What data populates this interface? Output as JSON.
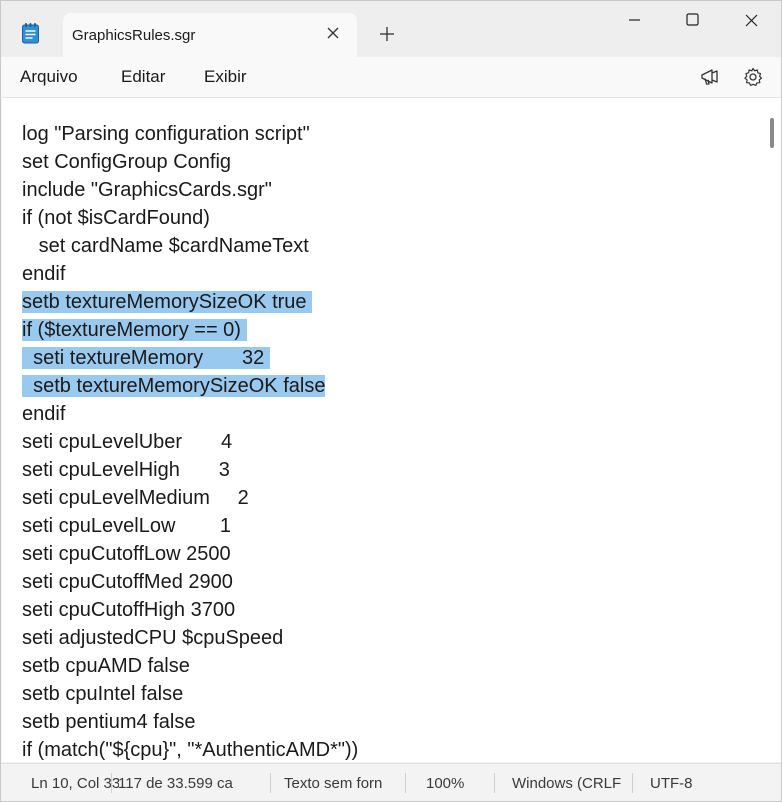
{
  "tab": {
    "title": "GraphicsRules.sgr"
  },
  "menu": {
    "arquivo": "Arquivo",
    "editar": "Editar",
    "exibir": "Exibir"
  },
  "editor": {
    "lines": [
      {
        "text": "log \"Parsing configuration script\"",
        "selected": false
      },
      {
        "text": "set ConfigGroup Config",
        "selected": false
      },
      {
        "text": "include \"GraphicsCards.sgr\"",
        "selected": false
      },
      {
        "text": "if (not $isCardFound)",
        "selected": false
      },
      {
        "text": "   set cardName $cardNameText",
        "selected": false
      },
      {
        "text": "endif",
        "selected": false
      },
      {
        "text": "setb textureMemorySizeOK true ",
        "selected": true
      },
      {
        "text": "if ($textureMemory == 0) ",
        "selected": true
      },
      {
        "text": "  seti textureMemory       32 ",
        "selected": true
      },
      {
        "text": "  setb textureMemorySizeOK false",
        "selected": true
      },
      {
        "text": "endif",
        "selected": false
      },
      {
        "text": "seti cpuLevelUber       4",
        "selected": false
      },
      {
        "text": "seti cpuLevelHigh       3",
        "selected": false
      },
      {
        "text": "seti cpuLevelMedium     2",
        "selected": false
      },
      {
        "text": "seti cpuLevelLow        1",
        "selected": false
      },
      {
        "text": "seti cpuCutoffLow 2500",
        "selected": false
      },
      {
        "text": "seti cpuCutoffMed 2900",
        "selected": false
      },
      {
        "text": "seti cpuCutoffHigh 3700",
        "selected": false
      },
      {
        "text": "seti adjustedCPU $cpuSpeed",
        "selected": false
      },
      {
        "text": "setb cpuAMD false",
        "selected": false
      },
      {
        "text": "setb cpuIntel false",
        "selected": false
      },
      {
        "text": "setb pentium4 false",
        "selected": false
      },
      {
        "text": "if (match(\"${cpu}\", \"*AuthenticAMD*\"))",
        "selected": false
      }
    ]
  },
  "status": {
    "position": "Ln 10, Col 33",
    "characters": "117 de 33.599 ca",
    "format": "Texto sem forn",
    "zoom": "100%",
    "line_ending": "Windows (CRLF",
    "encoding": "UTF-8"
  },
  "colors": {
    "selection": "#99c9ef",
    "tab_bg": "#f9f9f9",
    "titlebar_bg": "#eeeeee"
  }
}
